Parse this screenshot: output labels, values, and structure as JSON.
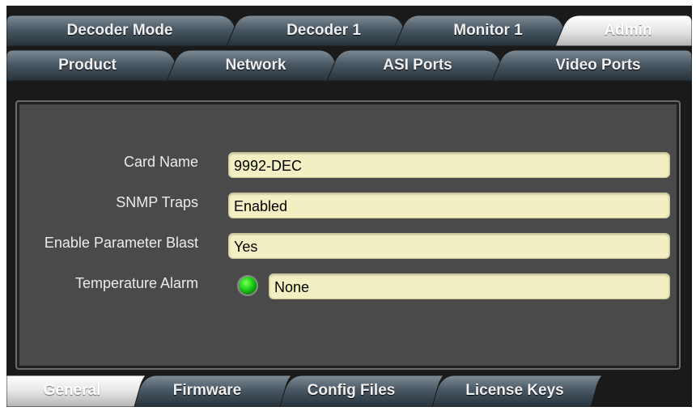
{
  "top_tabs": [
    {
      "label": "Decoder Mode",
      "active": false
    },
    {
      "label": "Decoder 1",
      "active": false
    },
    {
      "label": "Monitor 1",
      "active": false
    },
    {
      "label": "Admin",
      "active": true
    }
  ],
  "sub_tabs": [
    {
      "label": "Product"
    },
    {
      "label": "Network"
    },
    {
      "label": "ASI Ports"
    },
    {
      "label": "Video Ports"
    }
  ],
  "form": {
    "card_name": {
      "label": "Card Name",
      "value": "9992-DEC"
    },
    "snmp_traps": {
      "label": "SNMP Traps",
      "value": "Enabled"
    },
    "parameter_blast": {
      "label": "Enable Parameter Blast",
      "value": "Yes"
    },
    "temperature_alarm": {
      "label": "Temperature Alarm",
      "value": "None",
      "status_color": "#1fd41a"
    }
  },
  "bottom_tabs": [
    {
      "label": "General",
      "active": true
    },
    {
      "label": "Firmware",
      "active": false
    },
    {
      "label": "Config Files",
      "active": false
    },
    {
      "label": "License Keys",
      "active": false
    }
  ],
  "colors": {
    "tab_dark": "#3a4a57",
    "tab_active": "#d9d9d9",
    "field_bg": "#f2f0c2",
    "panel_bg": "#4a4a4a"
  }
}
